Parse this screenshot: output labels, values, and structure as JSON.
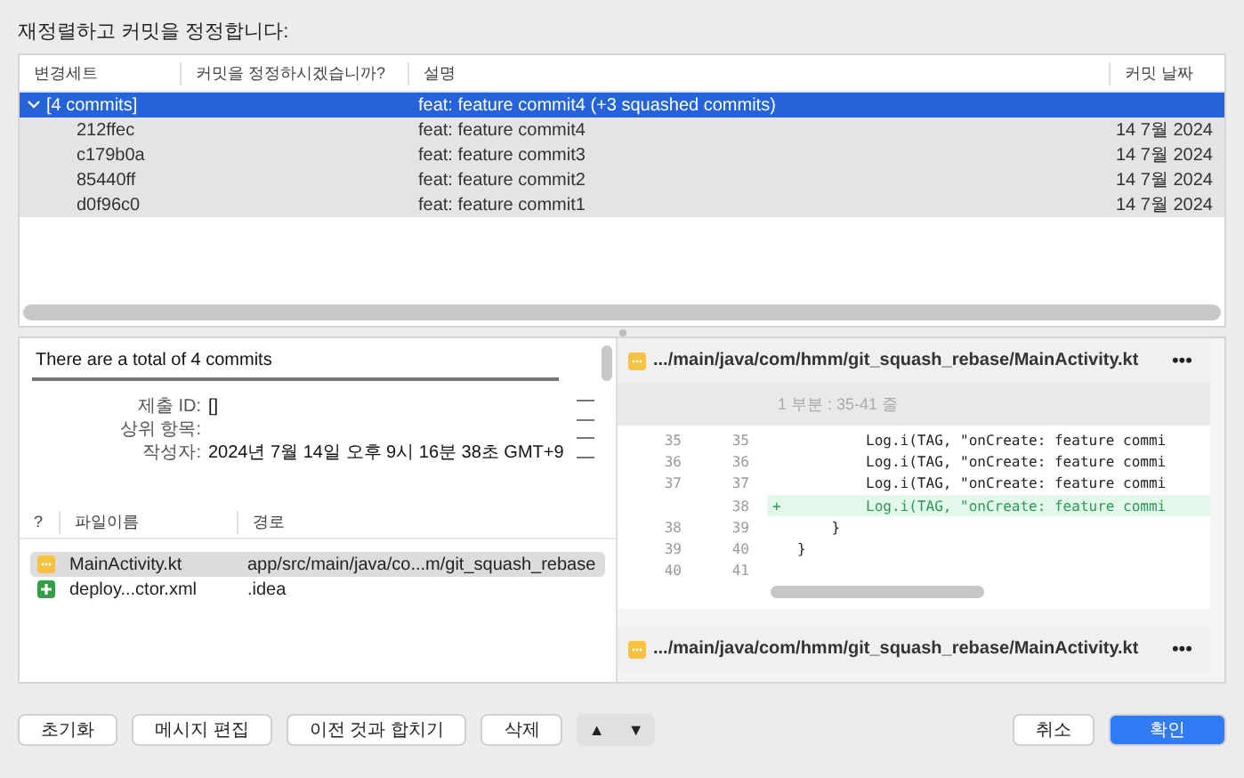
{
  "heading": "재정렬하고 커밋을 정정합니다:",
  "commits": {
    "columns": [
      "변경세트",
      "커밋을 정정하시겠습니까?",
      "설명",
      "커밋 날짜"
    ],
    "rows": [
      {
        "changeset": "[4 commits]",
        "description": "feat: feature commit4 (+3 squashed commits)",
        "selected": true,
        "expanded": true,
        "children": [
          {
            "changeset": "212ffec",
            "description": "feat: feature commit4",
            "date": "14 7월 2024",
            "selected": false
          },
          {
            "changeset": "c179b0a",
            "description": "feat: feature commit3",
            "date": "14 7월 2024",
            "selected": false
          },
          {
            "changeset": "85440ff",
            "description": "feat: feature commit2",
            "date": "14 7월 2024",
            "selected": false
          },
          {
            "changeset": "d0f96c0",
            "description": "feat: feature commit1",
            "date": "14 7월 2024",
            "selected": false
          }
        ]
      }
    ]
  },
  "details": {
    "title": "There are a total of 4 commits",
    "fields": [
      {
        "label": "제출 ID:",
        "value": "[]"
      },
      {
        "label": "상위 항목:"
      },
      {
        "label": "작성자:",
        "value": "2024년 7월 14일 오후 9시 16분 38초 GMT+9"
      }
    ]
  },
  "files": {
    "columns": [
      "?",
      "파일이름",
      "경로"
    ],
    "rows": [
      {
        "kind": "modified",
        "name": "MainActivity.kt",
        "path": "app/src/main/java/co...m/git_squash_rebase",
        "selected": true
      },
      {
        "kind": "added",
        "name": "deploy...ctor.xml",
        "path": ".idea",
        "selected": false
      }
    ]
  },
  "diff": {
    "files": [
      {
        "path": ".../main/java/com/hmm/git_squash_rebase/MainActivity.kt",
        "more": "•••",
        "hunk": "1 부분 : 35-41 줄",
        "lines": [
          {
            "old": "35",
            "new": "35",
            "code": "        Log.i(TAG, \"onCreate: feature commi",
            "added": false
          },
          {
            "old": "36",
            "new": "36",
            "code": "        Log.i(TAG, \"onCreate: feature commi",
            "added": false
          },
          {
            "old": "37",
            "new": "37",
            "code": "        Log.i(TAG, \"onCreate: feature commi",
            "added": false
          },
          {
            "new": "38",
            "sign": "+",
            "code": "        Log.i(TAG, \"onCreate: feature commi",
            "added": true
          },
          {
            "old": "38",
            "new": "39",
            "code": "    }",
            "added": false
          },
          {
            "old": "39",
            "new": "40",
            "code": "}",
            "added": false
          },
          {
            "old": "40",
            "new": "41",
            "added": false
          }
        ]
      },
      {
        "path": ".../main/java/com/hmm/git_squash_rebase/MainActivity.kt",
        "more": "•••"
      }
    ]
  },
  "buttons": [
    {
      "label": "초기화",
      "kind": "normal"
    },
    {
      "label": "메시지 편집",
      "kind": "normal"
    },
    {
      "label": "이전 것과 합치기",
      "kind": "normal"
    },
    {
      "label": "삭제",
      "kind": "normal"
    },
    {
      "label": "▲",
      "kind": "up"
    },
    {
      "label": "▼",
      "kind": "down"
    },
    {
      "label": "취소",
      "kind": "normal"
    },
    {
      "label": "확인",
      "kind": "primary"
    }
  ]
}
